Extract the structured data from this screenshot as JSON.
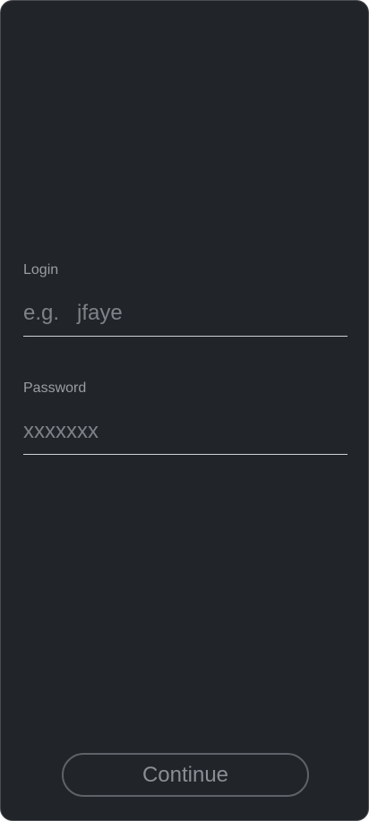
{
  "login": {
    "label": "Login",
    "placeholder": "e.g.   jfaye",
    "value": ""
  },
  "password": {
    "label": "Password",
    "placeholder": "xxxxxxx",
    "value": ""
  },
  "actions": {
    "continue_label": "Continue"
  },
  "colors": {
    "background": "#212428",
    "label_text": "#9a9ea4",
    "placeholder_text": "#7e838a",
    "underline": "#cfd2d6",
    "button_border": "#5f6369",
    "button_text": "#8a8f95"
  }
}
